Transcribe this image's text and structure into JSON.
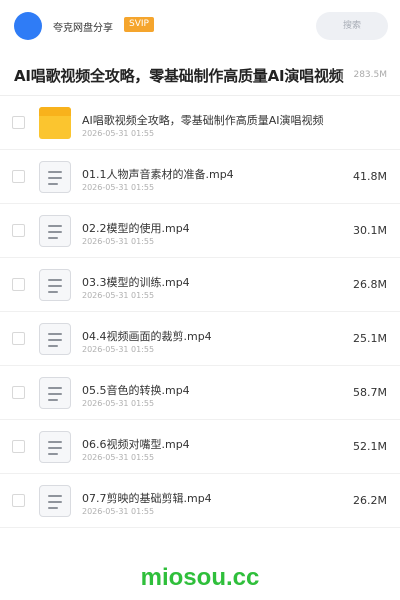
{
  "header": {
    "app_name": "夸克网盘分享",
    "badge": "SVIP",
    "search_placeholder": "搜索"
  },
  "share": {
    "title": "AI唱歌视频全攻略，零基础制作高质量AI演唱视频",
    "meta_size": "283.5M"
  },
  "files": [
    {
      "type": "folder",
      "name": "AI唱歌视频全攻略，零基础制作高质量AI演唱视频",
      "date": "2026-05-31 01:55",
      "size": ""
    },
    {
      "type": "video",
      "name": "01.1人物声音素材的准备.mp4",
      "date": "2026-05-31 01:55",
      "size": "41.8M"
    },
    {
      "type": "video",
      "name": "02.2模型的使用.mp4",
      "date": "2026-05-31 01:55",
      "size": "30.1M"
    },
    {
      "type": "video",
      "name": "03.3模型的训练.mp4",
      "date": "2026-05-31 01:55",
      "size": "26.8M"
    },
    {
      "type": "video",
      "name": "04.4视频画面的裁剪.mp4",
      "date": "2026-05-31 01:55",
      "size": "25.1M"
    },
    {
      "type": "video",
      "name": "05.5音色的转换.mp4",
      "date": "2026-05-31 01:55",
      "size": "58.7M"
    },
    {
      "type": "video",
      "name": "06.6视频对嘴型.mp4",
      "date": "2026-05-31 01:55",
      "size": "52.1M"
    },
    {
      "type": "video",
      "name": "07.7剪映的基础剪辑.mp4",
      "date": "2026-05-31 01:55",
      "size": "26.2M"
    }
  ],
  "watermark": "miosou.cc",
  "colors": {
    "avatar": "#2f7cf6",
    "svip_badge": "#f5a52d",
    "folder": "#fbc52f",
    "watermark": "#2fbf3b"
  }
}
